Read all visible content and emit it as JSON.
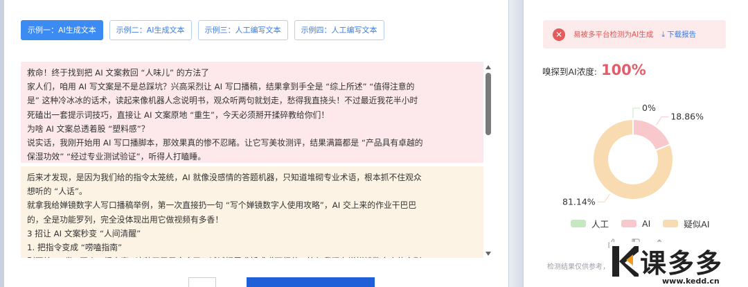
{
  "tabs": [
    {
      "label": "示例一：AI生成文本",
      "active": true
    },
    {
      "label": "示例二：AI生成文本",
      "active": false
    },
    {
      "label": "示例三：人工编写文本",
      "active": false
    },
    {
      "label": "示例四：人工编写文本",
      "active": false
    }
  ],
  "paragraphs": [
    {
      "tone": "pink",
      "lines": [
        "救命！终于找到把 AI 文案救回 “人味儿” 的方法了",
        "家人们，咱用 AI 写文案是不是总踩坑？兴高采烈让 AI 写口播稿，结果拿到手全是 “综上所述” “值得注意的",
        "是” 这种冷冰冰的话术，读起来像机器人念说明书，观众听两句就划走，愁得我直挠头！不过最近我花半小时",
        "死磕出一套提示词技巧，直接让 AI 文案原地 “重生”，今天必须掰开揉碎教给你们！",
        "为啥 AI 文案总透着股 “塑料感”？",
        "说实话，我刚开始用 AI 写口播脚本，那效果真的惨不忍睹。让它写美妆测评，结果满篇都是 “产品具有卓越的",
        "保湿功效” “经过专业测试验证”，听得人打瞌睡。"
      ]
    },
    {
      "tone": "cream",
      "lines": [
        "后来才发现，是因为我们给的指令太笼统，AI 就像没感情的答题机器，只知道堆砌专业术语，根本抓不住观众",
        "想听的 “人话”。",
        "就拿我给婵镜数字人写口播稿举例，第一次直接扔一句 “写个婵镜数字人使用攻略”，AI 交上来的作业干巴巴",
        "的，全是功能罗列，完全没体现出用它做视频有多香！",
        "3 招让 AI 文案秒变 “人间清醒”",
        "1. 把指令变成 “唠嗑指南”",
        "别再给 AI 发 “写个口播文案” 这种干巴巴命令了！试试把需求拆成唠下细节，比如我现在说婵镜数字人的文刊"
      ]
    }
  ],
  "result": {
    "alert_text": "易被多平台检测为AI生成",
    "download_label": "下载报告",
    "density_label": "嗅探到AI浓度:",
    "density_value": "100%",
    "footnote": "检测结果仅供参考，AI检测技术仍在完善中"
  },
  "colors": {
    "human": "#c5e8c0",
    "ai": "#f8c8cc",
    "suspected": "#f8dbb0",
    "accent": "#3b8bf2",
    "alert": "#e05858"
  },
  "chart_data": {
    "type": "pie",
    "donut": true,
    "categories": [
      "人工",
      "AI",
      "疑似AI"
    ],
    "values": [
      0,
      18.86,
      81.14
    ],
    "data_labels": [
      "0%",
      "18.86%",
      "81.14%"
    ],
    "legend": [
      "人工",
      "AI",
      "疑似AI"
    ],
    "legend_position": "bottom"
  },
  "watermark": {
    "text": "课多多",
    "url": "www.kedd.cn"
  },
  "icons": {
    "alert": "close-circle-icon",
    "download": "download-icon",
    "like": "thumbs-up-icon",
    "dislike": "thumbs-down-icon",
    "share": "share-icon"
  }
}
